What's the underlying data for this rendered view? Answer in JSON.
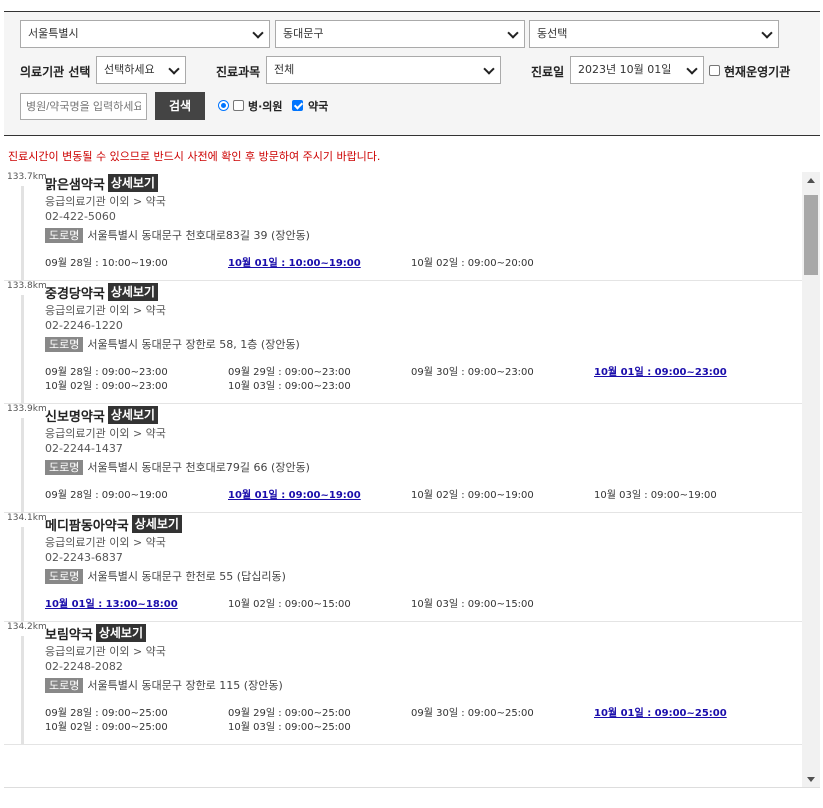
{
  "filters": {
    "city": "서울특별시",
    "district": "동대문구",
    "dong": "동선택",
    "institution_label": "의료기관 선택",
    "institution_value": "선택하세요",
    "department_label": "진료과목",
    "department_value": "전체",
    "date_label": "진료일",
    "date_value": "2023년 10월 01일",
    "open_now_label": "현재운영기관",
    "search_placeholder": "병원/약국명을 입력하세요",
    "search_button": "검색",
    "type_clinic": "병·의원",
    "type_pharmacy": "약국"
  },
  "notice": "진료시간이 변동될 수 있으므로 반드시 사전에 확인 후 방문하여 주시기 바랍니다.",
  "labels": {
    "detail": "상세보기",
    "road": "도로명"
  },
  "pharmacies": [
    {
      "distance": "133.7km",
      "name": "맑은샘약국",
      "category": "응급의료기관 이외 > 약국",
      "phone": "02-422-5060",
      "address": "서울특별시 동대문구 천호대로83길 39 (장안동)",
      "hours": [
        {
          "date": "09월 28일",
          "time": "10:00~19:00",
          "today": false
        },
        {
          "date": "10월 01일",
          "time": "10:00~19:00",
          "today": true
        },
        {
          "date": "10월 02일",
          "time": "09:00~20:00",
          "today": false
        }
      ]
    },
    {
      "distance": "133.8km",
      "name": "중경당약국",
      "category": "응급의료기관 이외 > 약국",
      "phone": "02-2246-1220",
      "address": "서울특별시 동대문구 장한로 58, 1층 (장안동)",
      "hours": [
        {
          "date": "09월 28일",
          "time": "09:00~23:00",
          "today": false
        },
        {
          "date": "09월 29일",
          "time": "09:00~23:00",
          "today": false
        },
        {
          "date": "09월 30일",
          "time": "09:00~23:00",
          "today": false
        },
        {
          "date": "10월 01일",
          "time": "09:00~23:00",
          "today": true
        },
        {
          "date": "10월 02일",
          "time": "09:00~23:00",
          "today": false
        },
        {
          "date": "10월 03일",
          "time": "09:00~23:00",
          "today": false
        }
      ]
    },
    {
      "distance": "133.9km",
      "name": "신보명약국",
      "category": "응급의료기관 이외 > 약국",
      "phone": "02-2244-1437",
      "address": "서울특별시 동대문구 천호대로79길 66 (장안동)",
      "hours": [
        {
          "date": "09월 28일",
          "time": "09:00~19:00",
          "today": false
        },
        {
          "date": "10월 01일",
          "time": "09:00~19:00",
          "today": true
        },
        {
          "date": "10월 02일",
          "time": "09:00~19:00",
          "today": false
        },
        {
          "date": "10월 03일",
          "time": "09:00~19:00",
          "today": false
        }
      ]
    },
    {
      "distance": "134.1km",
      "name": "메디팜동아약국",
      "category": "응급의료기관 이외 > 약국",
      "phone": "02-2243-6837",
      "address": "서울특별시 동대문구 한천로 55 (답십리동)",
      "hours": [
        {
          "date": "10월 01일",
          "time": "13:00~18:00",
          "today": true
        },
        {
          "date": "10월 02일",
          "time": "09:00~15:00",
          "today": false
        },
        {
          "date": "10월 03일",
          "time": "09:00~15:00",
          "today": false
        }
      ]
    },
    {
      "distance": "134.2km",
      "name": "보림약국",
      "category": "응급의료기관 이외 > 약국",
      "phone": "02-2248-2082",
      "address": "서울특별시 동대문구 장한로 115 (장안동)",
      "hours": [
        {
          "date": "09월 28일",
          "time": "09:00~25:00",
          "today": false
        },
        {
          "date": "09월 29일",
          "time": "09:00~25:00",
          "today": false
        },
        {
          "date": "09월 30일",
          "time": "09:00~25:00",
          "today": false
        },
        {
          "date": "10월 01일",
          "time": "09:00~25:00",
          "today": true
        },
        {
          "date": "10월 02일",
          "time": "09:00~25:00",
          "today": false
        },
        {
          "date": "10월 03일",
          "time": "09:00~25:00",
          "today": false
        }
      ]
    }
  ]
}
